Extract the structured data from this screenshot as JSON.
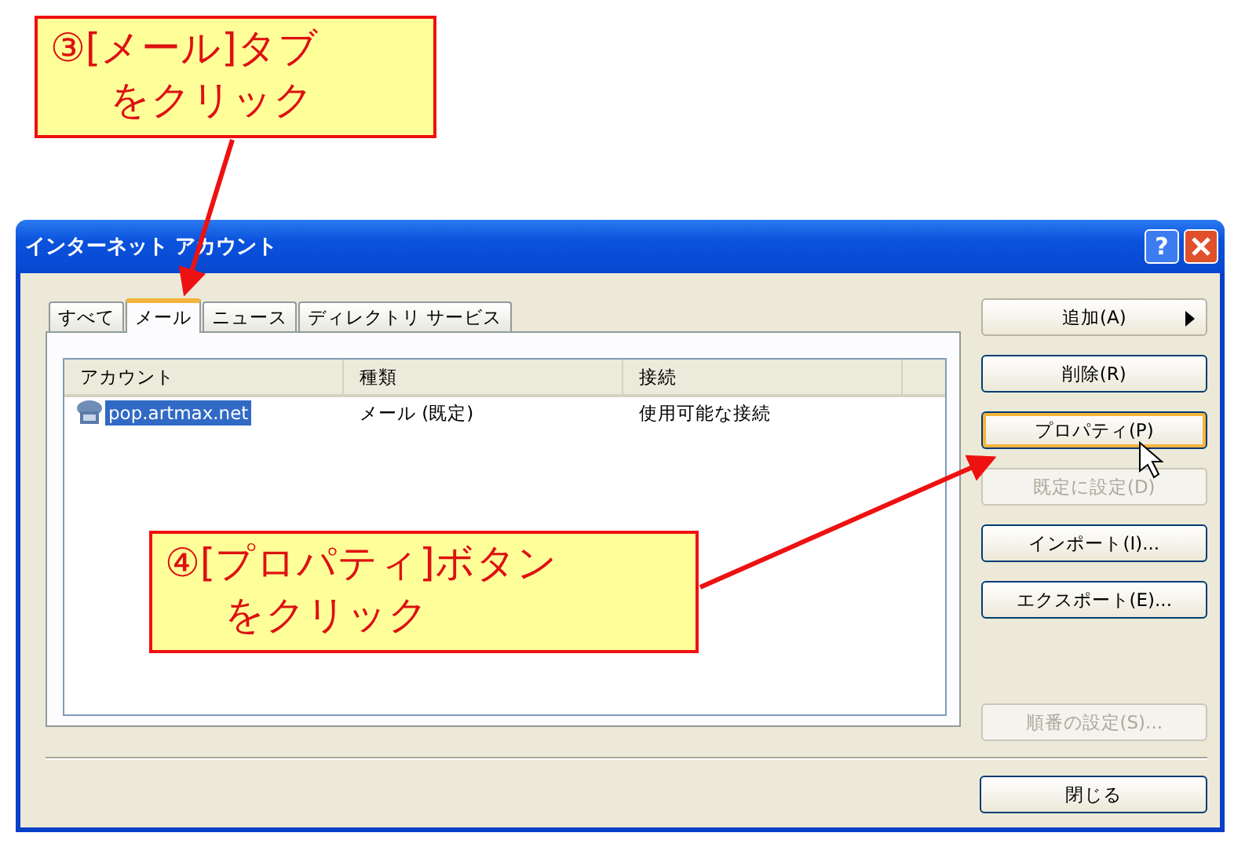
{
  "window": {
    "title": "インターネット アカウント",
    "help_button": "?"
  },
  "tabs": [
    {
      "label": "すべて",
      "selected": false
    },
    {
      "label": "メール",
      "selected": true
    },
    {
      "label": "ニュース",
      "selected": false
    },
    {
      "label": "ディレクトリ サービス",
      "selected": false
    }
  ],
  "table": {
    "columns": [
      "アカウント",
      "種類",
      "接続"
    ],
    "rows": [
      {
        "cells": [
          "pop.artmax.net",
          "メール (既定)",
          "使用可能な接続"
        ],
        "selected": true
      }
    ]
  },
  "buttons": [
    {
      "label": "追加(A)",
      "kind": "menu",
      "disabled": false,
      "hovered": false
    },
    {
      "label": "削除(R)",
      "kind": "plain",
      "disabled": false,
      "hovered": false
    },
    {
      "label": "プロパティ(P)",
      "kind": "plain",
      "disabled": false,
      "hovered": true
    },
    {
      "label": "既定に設定(D)",
      "kind": "plain",
      "disabled": true,
      "hovered": false
    },
    {
      "label": "インポート(I)...",
      "kind": "plain",
      "disabled": false,
      "hovered": false
    },
    {
      "label": "エクスポート(E)...",
      "kind": "plain",
      "disabled": false,
      "hovered": false
    },
    {
      "label": "順番の設定(S)...",
      "kind": "spaced",
      "disabled": true,
      "hovered": false
    }
  ],
  "close_button": "閉じる",
  "callouts": [
    {
      "lines": [
        "③[メール]タブ",
        "をクリック"
      ]
    },
    {
      "lines": [
        "④[プロパティ]ボタン",
        "をクリック"
      ]
    }
  ]
}
